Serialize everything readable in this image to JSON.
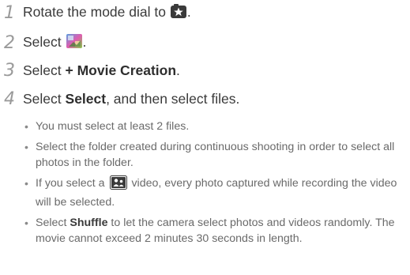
{
  "steps": [
    {
      "num": "1",
      "pre": "Rotate the mode dial to",
      "post": "."
    },
    {
      "num": "2",
      "pre": "Select",
      "post": "."
    },
    {
      "num": "3",
      "pre": "Select",
      "bold": "+ Movie Creation",
      "post": "."
    },
    {
      "num": "4",
      "pre": "Select",
      "bold": "Select",
      "post": ", and then select files."
    }
  ],
  "bullets": [
    {
      "text": "You must select at least 2 files."
    },
    {
      "text": "Select the folder created during continuous shooting in order to select all photos in the folder."
    },
    {
      "pre": "If you select a",
      "post": "video, every photo captured while recording the video will be selected."
    },
    {
      "pre": "Select",
      "bold": "Shuffle",
      "post": "to let the camera select photos and videos randomly. The movie cannot exceed 2 minutes 30 seconds in length."
    }
  ],
  "icons": {
    "mode_dial": "star-mode-icon",
    "step2": "movie-collage-icon",
    "video": "person-video-icon"
  },
  "colors": {
    "text": "#3a3a3a",
    "step_number": "#9a9a9a",
    "bullet_text": "#6a6a6a"
  }
}
